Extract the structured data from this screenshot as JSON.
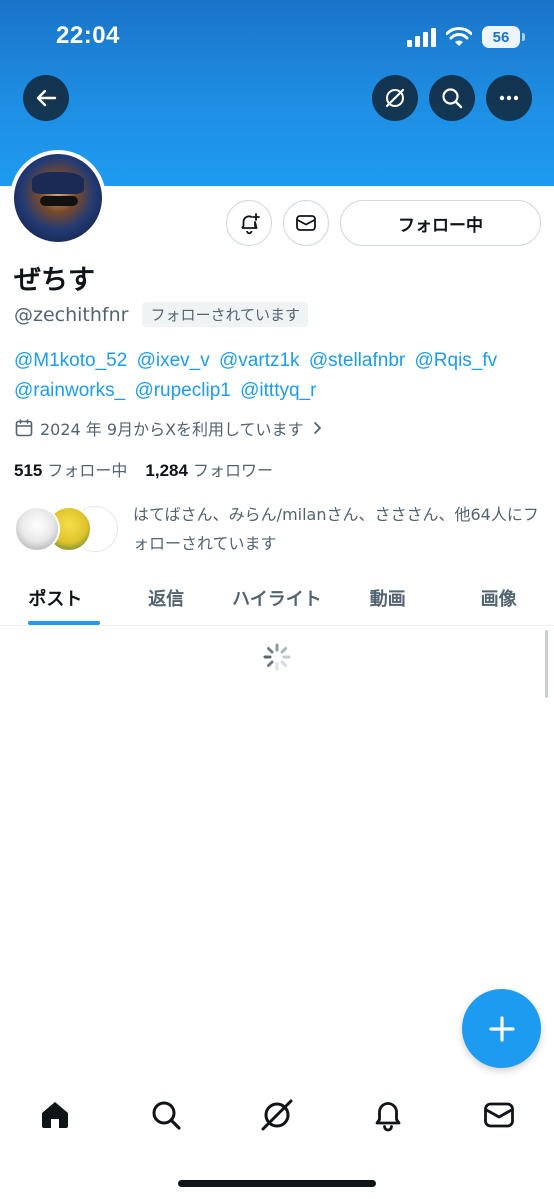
{
  "status_bar": {
    "time": "22:04",
    "battery": "56"
  },
  "header": {
    "icons": [
      "back-arrow-icon",
      "grok-icon",
      "search-icon",
      "more-icon"
    ]
  },
  "profile": {
    "follow_button_label": "フォロー中",
    "display_name": "ぜちす",
    "handle": "@zechithfnr",
    "follows_you_badge": "フォローされています",
    "bio_mentions": [
      "@M1koto_52",
      "@ixev_v",
      "@vartz1k",
      "@stellafnbr",
      "@Rqis_fv",
      "@rainworks_",
      "@rupeclip1",
      "@itttyq_r"
    ],
    "joined": "2024 年 9月からXを利用しています",
    "following_count": "515",
    "following_label": "フォロー中",
    "followers_count": "1,284",
    "followers_label": "フォロワー",
    "followed_by_text": "はてばさん、みらん/milanさん、さささん、他64人にフォローされています"
  },
  "tabs": [
    "ポスト",
    "返信",
    "ハイライト",
    "動画",
    "画像"
  ],
  "active_tab_index": 0,
  "bottom_nav": [
    "home-icon",
    "search-icon",
    "grok-icon",
    "notifications-icon",
    "messages-icon"
  ],
  "colors": {
    "accent": "#1d9bf0",
    "banner": "#1e8ee3",
    "text_secondary": "#536471"
  }
}
